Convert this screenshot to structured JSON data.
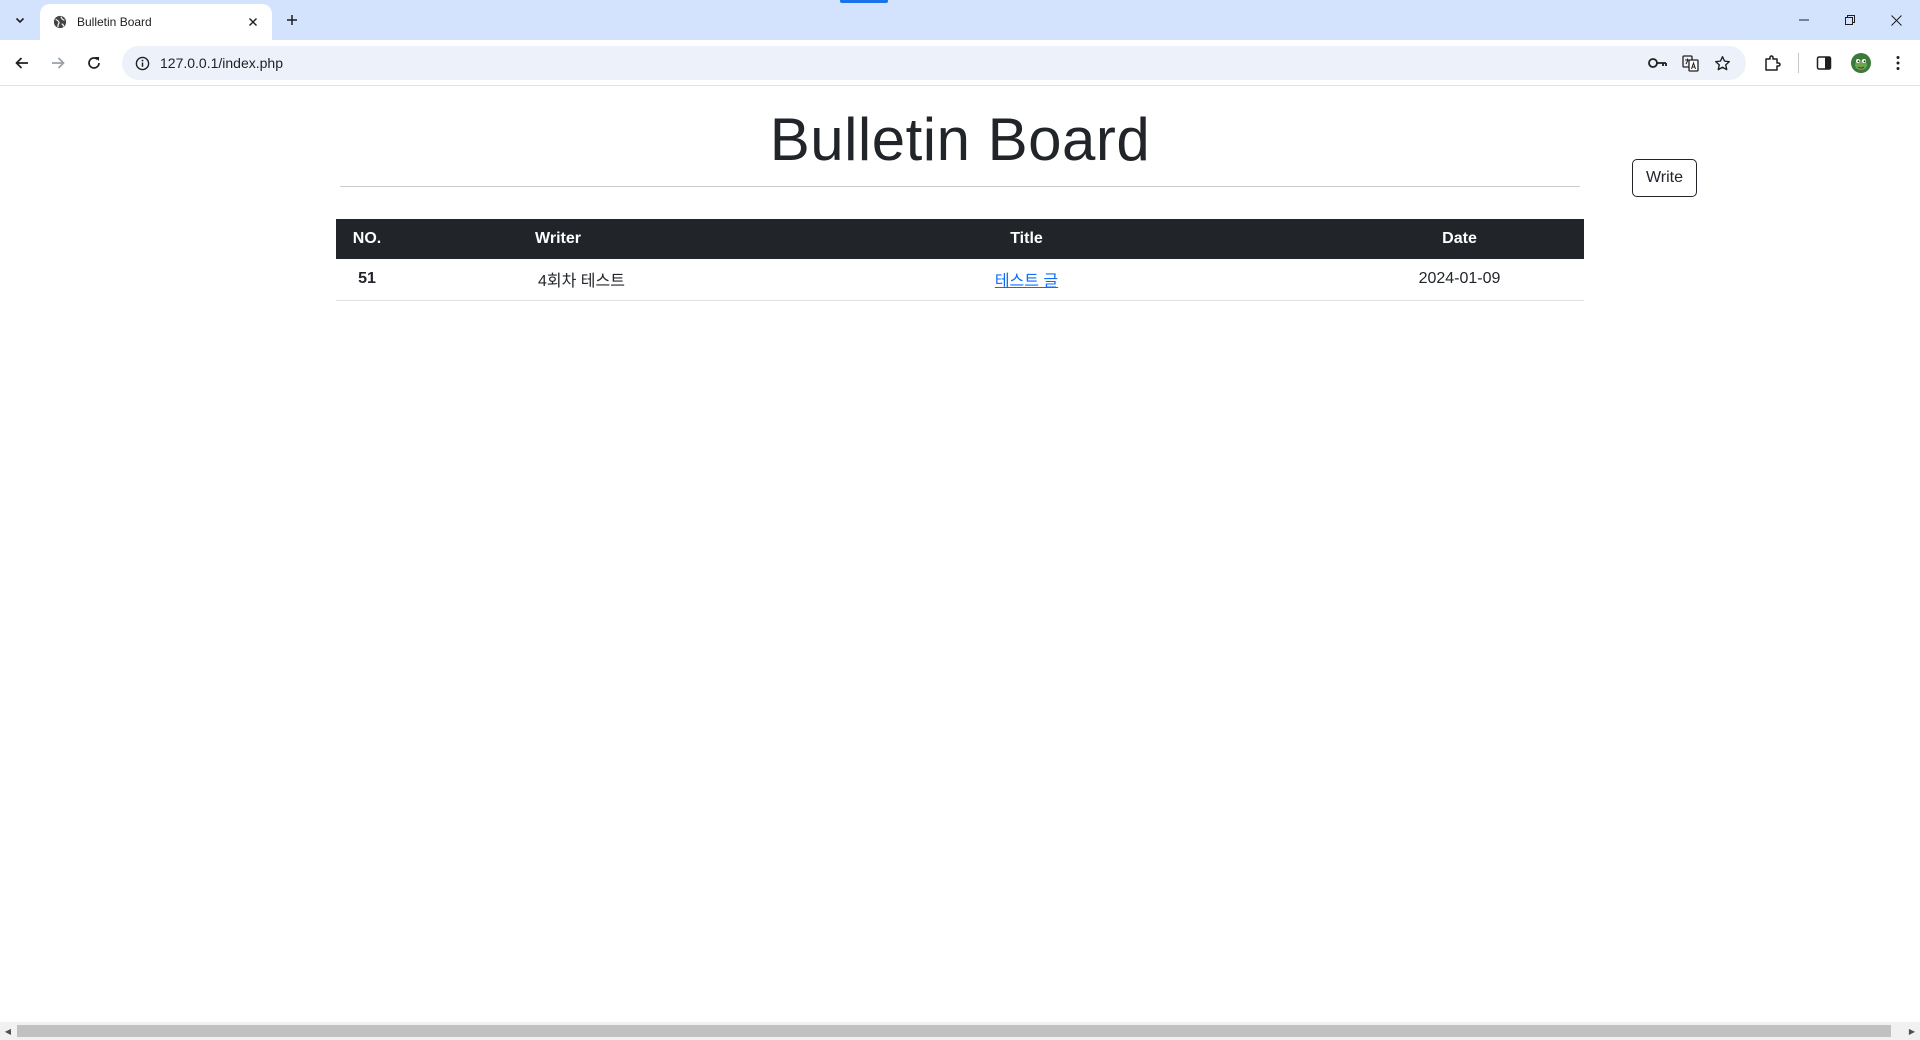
{
  "browser": {
    "tab": {
      "title": "Bulletin Board",
      "favicon": "globe-icon"
    },
    "new_tab_icon": "plus-icon",
    "url": "127.0.0.1/index.php",
    "window_controls": [
      "minimize-icon",
      "restore-icon",
      "close-icon"
    ],
    "toolbar_icons": [
      "key-icon",
      "translate-icon",
      "star-icon",
      "extensions-icon",
      "side-panel-icon",
      "profile-avatar",
      "menu-icon"
    ]
  },
  "page": {
    "title": "Bulletin Board",
    "write_button": "Write"
  },
  "table": {
    "headers": {
      "no": "NO.",
      "writer": "Writer",
      "title": "Title",
      "date": "Date"
    },
    "rows": [
      {
        "no": "51",
        "writer": "4회차 테스트",
        "title": "테스트 글",
        "date": "2024-01-09"
      }
    ]
  },
  "colors": {
    "tabbar": "#d3e3fd",
    "table_header": "#212529",
    "link": "#0d6efd"
  }
}
